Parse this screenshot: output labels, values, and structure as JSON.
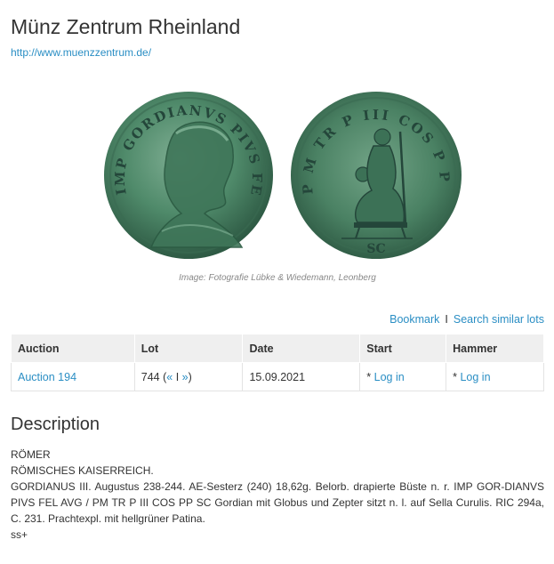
{
  "header": {
    "title": "Münz Zentrum Rheinland",
    "url": "http://www.muenzzentrum.de/"
  },
  "image": {
    "caption": "Image: Fotografie Lübke & Wiedemann, Leonberg",
    "obverse_legend": "IMP GORDIANVS PIVS FEL AVG",
    "reverse_legend": "P M TR P III COS P P",
    "reverse_exergue": "SC"
  },
  "actions": {
    "bookmark": "Bookmark",
    "separator": "I",
    "search_similar": "Search similar lots"
  },
  "table": {
    "headers": [
      "Auction",
      "Lot",
      "Date",
      "Start",
      "Hammer"
    ],
    "row": {
      "auction": "Auction 194",
      "lot_number": "744",
      "lot_nav_open": "(",
      "lot_prev": "«",
      "lot_nav_sep": "I",
      "lot_next": "»",
      "lot_nav_close": ")",
      "date": "15.09.2021",
      "start_prefix": "*",
      "start_link": "Log in",
      "hammer_prefix": "*",
      "hammer_link": "Log in"
    }
  },
  "description": {
    "heading": "Description",
    "line1": "RÖMER",
    "line2": "RÖMISCHES KAISERREICH.",
    "body": "GORDIANUS III. Augustus 238-244. AE-Sesterz (240) 18,62g. Belorb. drapierte Büste n. r. IMP GOR-DIANVS PIVS FEL AVG / PM TR P III COS PP SC Gordian mit Globus und Zepter sitzt n. l. auf Sella Curulis. RIC 294a, C. 231. Prachtexpl. mit hellgrüner Patina.",
    "grade": "ss+"
  },
  "colors": {
    "link": "#2a8ec4",
    "text": "#333333",
    "table_header_bg": "#efefef",
    "coin_patina": "#4f8a6a"
  }
}
